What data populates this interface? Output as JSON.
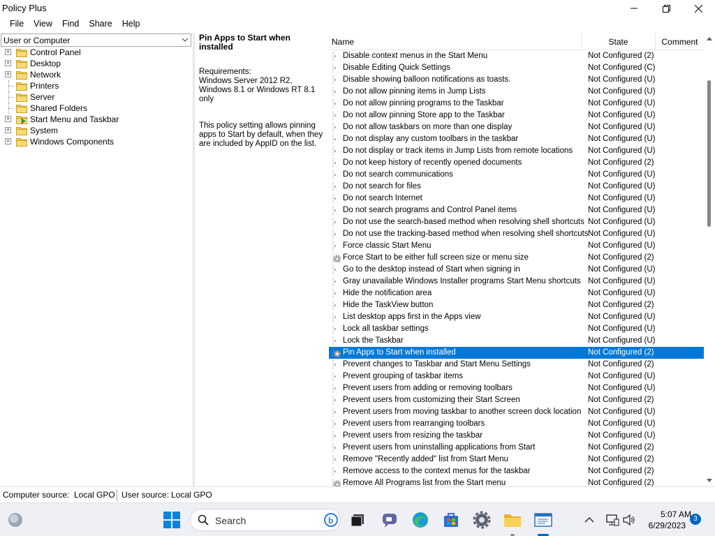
{
  "window": {
    "title": "Policy Plus"
  },
  "menu": [
    "File",
    "View",
    "Find",
    "Share",
    "Help"
  ],
  "scope": {
    "selected": "User or Computer"
  },
  "tree": [
    {
      "label": "Control Panel",
      "expandable": true,
      "icon": "folder-icon"
    },
    {
      "label": "Desktop",
      "expandable": true,
      "icon": "folder-icon"
    },
    {
      "label": "Network",
      "expandable": true,
      "icon": "folder-icon"
    },
    {
      "label": "Printers",
      "expandable": false,
      "icon": "folder-icon"
    },
    {
      "label": "Server",
      "expandable": false,
      "icon": "folder-icon"
    },
    {
      "label": "Shared Folders",
      "expandable": false,
      "icon": "folder-icon"
    },
    {
      "label": "Start Menu and Taskbar",
      "expandable": true,
      "icon": "folder-open-arrow-icon",
      "selected": true
    },
    {
      "label": "System",
      "expandable": true,
      "icon": "folder-icon"
    },
    {
      "label": "Windows Components",
      "expandable": true,
      "icon": "folder-icon"
    }
  ],
  "description": {
    "title": "Pin Apps to Start when installed",
    "requirements_label": "Requirements:",
    "requirements": "Windows Server 2012 R2, Windows 8.1 or Windows RT 8.1 only",
    "body": "This policy setting allows pinning apps to Start by default, when they are included by AppID on the list."
  },
  "list": {
    "columns": {
      "name": "Name",
      "state": "State",
      "comment": "Comment"
    },
    "rows": [
      {
        "name": "Disable context menus in the Start Menu",
        "state": "Not Configured (2)"
      },
      {
        "name": "Disable Editing Quick Settings",
        "state": "Not Configured (C)"
      },
      {
        "name": "Disable showing balloon notifications as toasts.",
        "state": "Not Configured (U)"
      },
      {
        "name": "Do not allow pinning items in Jump Lists",
        "state": "Not Configured (U)"
      },
      {
        "name": "Do not allow pinning programs to the Taskbar",
        "state": "Not Configured (U)"
      },
      {
        "name": "Do not allow pinning Store app to the Taskbar",
        "state": "Not Configured (U)"
      },
      {
        "name": "Do not allow taskbars on more than one display",
        "state": "Not Configured (U)"
      },
      {
        "name": "Do not display any custom toolbars in the taskbar",
        "state": "Not Configured (U)"
      },
      {
        "name": "Do not display or track items in Jump Lists from remote locations",
        "state": "Not Configured (U)"
      },
      {
        "name": "Do not keep history of recently opened documents",
        "state": "Not Configured (2)"
      },
      {
        "name": "Do not search communications",
        "state": "Not Configured (U)"
      },
      {
        "name": "Do not search for files",
        "state": "Not Configured (U)"
      },
      {
        "name": "Do not search Internet",
        "state": "Not Configured (U)"
      },
      {
        "name": "Do not search programs and Control Panel items",
        "state": "Not Configured (U)"
      },
      {
        "name": "Do not use the search-based method when resolving shell shortcuts",
        "state": "Not Configured (U)"
      },
      {
        "name": "Do not use the tracking-based method when resolving shell shortcuts",
        "state": "Not Configured (U)"
      },
      {
        "name": "Force classic Start Menu",
        "state": "Not Configured (U)"
      },
      {
        "name": "Force Start to be either full screen size or menu size",
        "state": "Not Configured (2)",
        "icon": "gear-policy-icon"
      },
      {
        "name": "Go to the desktop instead of Start when signing in",
        "state": "Not Configured (U)"
      },
      {
        "name": "Gray unavailable Windows Installer programs Start Menu shortcuts",
        "state": "Not Configured (U)"
      },
      {
        "name": "Hide the notification area",
        "state": "Not Configured (U)"
      },
      {
        "name": "Hide the TaskView button",
        "state": "Not Configured (2)"
      },
      {
        "name": "List desktop apps first in the Apps view",
        "state": "Not Configured (U)"
      },
      {
        "name": "Lock all taskbar settings",
        "state": "Not Configured (U)"
      },
      {
        "name": "Lock the Taskbar",
        "state": "Not Configured (U)"
      },
      {
        "name": "Pin Apps to Start when installed",
        "state": "Not Configured (2)",
        "selected": true,
        "icon": "gear-policy-icon"
      },
      {
        "name": "Prevent changes to Taskbar and Start Menu Settings",
        "state": "Not Configured (2)"
      },
      {
        "name": "Prevent grouping of taskbar items",
        "state": "Not Configured (U)"
      },
      {
        "name": "Prevent users from adding or removing toolbars",
        "state": "Not Configured (U)"
      },
      {
        "name": "Prevent users from customizing their Start Screen",
        "state": "Not Configured (2)"
      },
      {
        "name": "Prevent users from moving taskbar to another screen dock location",
        "state": "Not Configured (U)"
      },
      {
        "name": "Prevent users from rearranging toolbars",
        "state": "Not Configured (U)"
      },
      {
        "name": "Prevent users from resizing the taskbar",
        "state": "Not Configured (U)"
      },
      {
        "name": "Prevent users from uninstalling applications from Start",
        "state": "Not Configured (2)"
      },
      {
        "name": "Remove \"Recently added\" list from Start Menu",
        "state": "Not Configured (2)"
      },
      {
        "name": "Remove access to the context menus for the taskbar",
        "state": "Not Configured (2)"
      },
      {
        "name": "Remove All Programs list from the Start menu",
        "state": "Not Configured (2)",
        "icon": "gear-policy-icon"
      }
    ]
  },
  "status": {
    "computer_label": "Computer source:",
    "computer_value": "Local GPO",
    "user_label": "User source:",
    "user_value": "Local GPO"
  },
  "taskbar": {
    "search_placeholder": "Search",
    "time": "5:07 AM",
    "date": "6/29/2023",
    "notification_count": "3",
    "accent_color": "#0067c0"
  },
  "colors": {
    "selection": "#0078d7",
    "folder": "#f0c850"
  }
}
